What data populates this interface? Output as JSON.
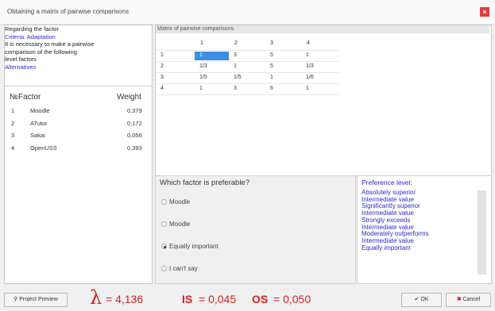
{
  "window": {
    "title": "Obtaining a matrix of pairwise comparisons",
    "close_label": "×"
  },
  "left_panel": {
    "info_lines": [
      "Regarding the factor",
      "Criteria. Adaptation",
      "It is necessary to make a pairwise",
      "comparison of the following",
      "level factors"
    ],
    "link": "Alternatives",
    "table_headers": {
      "num": "№",
      "factor": "Factor",
      "weight": "Weight"
    },
    "factors": [
      {
        "num": "1",
        "name": "Moodle",
        "weight": "0,379"
      },
      {
        "num": "2",
        "name": "ATutor",
        "weight": "0,172"
      },
      {
        "num": "3",
        "name": "Sakai",
        "weight": "0,056"
      },
      {
        "num": "4",
        "name": "OpenUSS",
        "weight": "0,393"
      }
    ]
  },
  "matrix": {
    "title": "Matrix of pairwise comparisons",
    "col_headers": [
      "1",
      "2",
      "3",
      "4"
    ],
    "rows": [
      {
        "label": "1",
        "cells": [
          "1",
          "3",
          "5",
          "1"
        ]
      },
      {
        "label": "2",
        "cells": [
          "1/3",
          "1",
          "5",
          "1/3"
        ]
      },
      {
        "label": "3",
        "cells": [
          "1/5",
          "1/5",
          "1",
          "1/6"
        ]
      },
      {
        "label": "4",
        "cells": [
          "1",
          "3",
          "6",
          "1"
        ]
      }
    ]
  },
  "question": {
    "title": "Which factor is preferable?",
    "options": [
      {
        "label": "Moodle",
        "checked": false
      },
      {
        "label": "Moodle",
        "checked": false
      },
      {
        "label": "Equally important",
        "checked": true
      },
      {
        "label": "I can't say",
        "checked": false
      }
    ]
  },
  "preference": {
    "title": "Preference level:",
    "levels": [
      "Absolutely superior",
      "Intermediate value",
      "Significantly superior",
      "Intermediate value",
      "Strongly exceeds",
      "Intermediate value",
      "Moderately outperforms",
      "Intermediate value",
      "Equally important"
    ]
  },
  "footer": {
    "preview_label": "Project Preview",
    "lambda_symbol": "λ",
    "lambda_value": "= 4,136",
    "is_label": "IS",
    "is_value": "= 0,045",
    "os_label": "OS",
    "os_value": "= 0,050",
    "ok_label": "OK",
    "cancel_label": "Cancel"
  },
  "colors": {
    "accent_blue": "#2a2ad0",
    "metric_red": "#d81e1e",
    "selection": "#3d8ee0"
  }
}
